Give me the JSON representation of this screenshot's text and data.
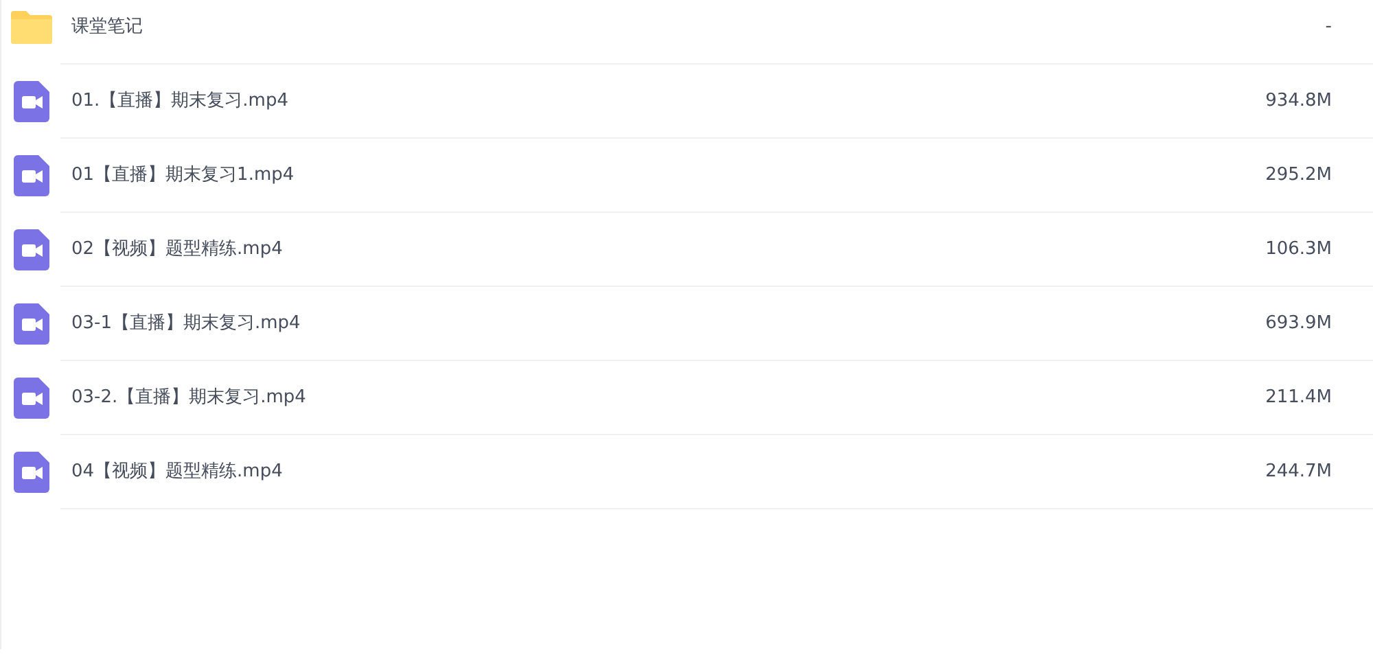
{
  "files": [
    {
      "kind": "folder",
      "name": "课堂笔记",
      "size": "-"
    },
    {
      "kind": "video",
      "name": "01.【直播】期末复习.mp4",
      "size": "934.8M"
    },
    {
      "kind": "video",
      "name": "01【直播】期末复习1.mp4",
      "size": "295.2M"
    },
    {
      "kind": "video",
      "name": "02【视频】题型精练.mp4",
      "size": "106.3M"
    },
    {
      "kind": "video",
      "name": "03-1【直播】期末复习.mp4",
      "size": "693.9M"
    },
    {
      "kind": "video",
      "name": "03-2.【直播】期末复习.mp4",
      "size": "211.4M"
    },
    {
      "kind": "video",
      "name": "04【视频】题型精练.mp4",
      "size": "244.7M"
    }
  ]
}
